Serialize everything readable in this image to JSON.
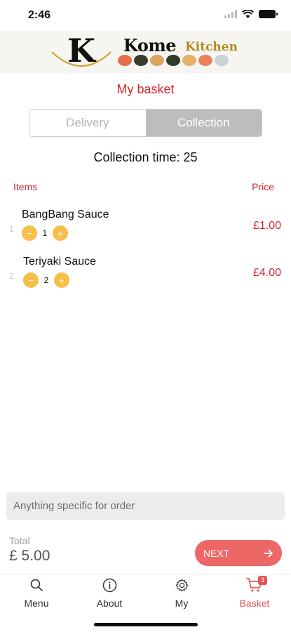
{
  "status_bar": {
    "time": "2:46"
  },
  "brand": {
    "letter": "K",
    "word1": "Kome",
    "word2": "Kitchen"
  },
  "colors": {
    "accent": "#d1272d",
    "qty_button": "#f7bf4a",
    "next_button": "#ee6767",
    "tab_active": "#e25656"
  },
  "page_title": "My basket",
  "mode_toggle": {
    "options": [
      "Delivery",
      "Collection"
    ],
    "selected": "Collection"
  },
  "collection_time": "Collection time: 25",
  "table_headers": {
    "items": "Items",
    "price": "Price"
  },
  "items": [
    {
      "index": "1",
      "name": "BangBang Sauce",
      "quantity": "1",
      "price": "£1.00"
    },
    {
      "index": "2",
      "name": "Teriyaki Sauce",
      "quantity": "2",
      "price": "£4.00"
    }
  ],
  "order_note": {
    "placeholder": "Anything specific for order"
  },
  "total": {
    "label": "Total",
    "value": "£ 5.00"
  },
  "next_button": {
    "label": "NEXT"
  },
  "tabbar": {
    "tabs": [
      {
        "label": "Menu",
        "icon": "search-icon"
      },
      {
        "label": "About",
        "icon": "info-icon"
      },
      {
        "label": "My",
        "icon": "gear-icon"
      },
      {
        "label": "Basket",
        "icon": "cart-icon",
        "badge": "3",
        "active": true
      }
    ]
  }
}
